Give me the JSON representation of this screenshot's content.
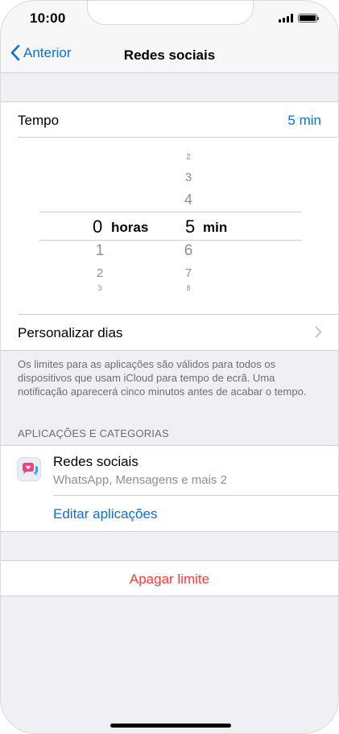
{
  "status_bar": {
    "time": "10:00",
    "icons": [
      "signal-icon",
      "battery-icon"
    ]
  },
  "nav": {
    "back_label": "Anterior",
    "title": "Redes sociais",
    "back_icon": "chevron-left-icon"
  },
  "time_row": {
    "label": "Tempo",
    "value": "5 min"
  },
  "picker": {
    "hours": {
      "above": [
        "",
        "",
        ""
      ],
      "selected": "0",
      "unit": "horas",
      "below": [
        "1",
        "2",
        "3"
      ]
    },
    "minutes": {
      "above": [
        "2",
        "3",
        "4"
      ],
      "selected": "5",
      "unit": "min",
      "below": [
        "6",
        "7",
        "8"
      ]
    }
  },
  "customize_days": {
    "label": "Personalizar dias",
    "icon": "chevron-right-icon"
  },
  "footer_note": "Os limites para as aplicações são válidos para todos os dispositivos que usam iCloud para tempo de ecrã. Uma notificação aparecerá cinco minutos antes de acabar o tempo.",
  "apps_section": {
    "header": "APLICAÇÕES E CATEGORIAS",
    "item": {
      "title": "Redes sociais",
      "subtitle": "WhatsApp, Mensagens e mais 2",
      "icon": "social-networks-icon"
    },
    "edit_label": "Editar aplicações"
  },
  "delete_label": "Apagar limite",
  "colors": {
    "accent": "#0a6fd6",
    "destructive": "#ff3b30",
    "background": "#efeff4"
  }
}
